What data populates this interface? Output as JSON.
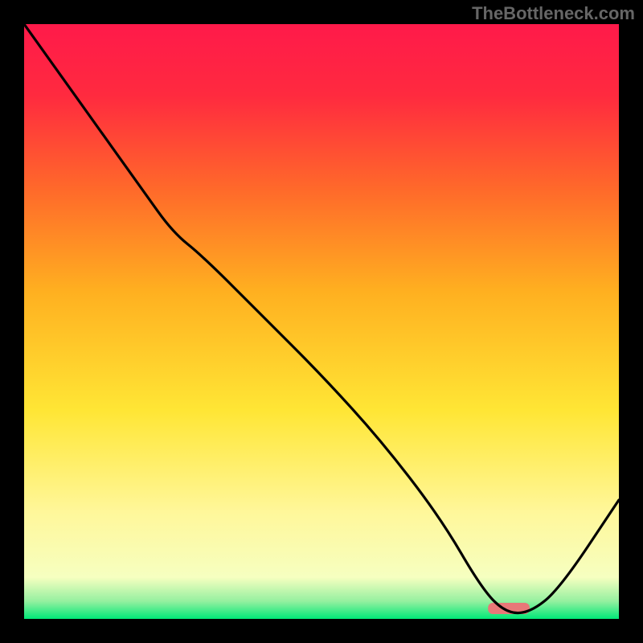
{
  "watermark": "TheBottleneck.com",
  "chart_data": {
    "type": "line",
    "title": "",
    "xlabel": "",
    "ylabel": "",
    "xlim": [
      0,
      100
    ],
    "ylim": [
      0,
      100
    ],
    "grid": false,
    "x": [
      0,
      10,
      20,
      25,
      30,
      40,
      50,
      60,
      70,
      77,
      81,
      85,
      90,
      100
    ],
    "values": [
      100,
      86,
      72,
      65,
      61,
      51,
      41,
      30,
      17,
      5,
      1,
      1,
      5,
      20
    ],
    "optimal_range_x": [
      78,
      85
    ],
    "colors": {
      "curve": "#000000",
      "marker": "#e87878",
      "gradient_top": "#ff1a4a",
      "gradient_mid": "#ffe635",
      "gradient_bottom": "#00e878"
    }
  }
}
